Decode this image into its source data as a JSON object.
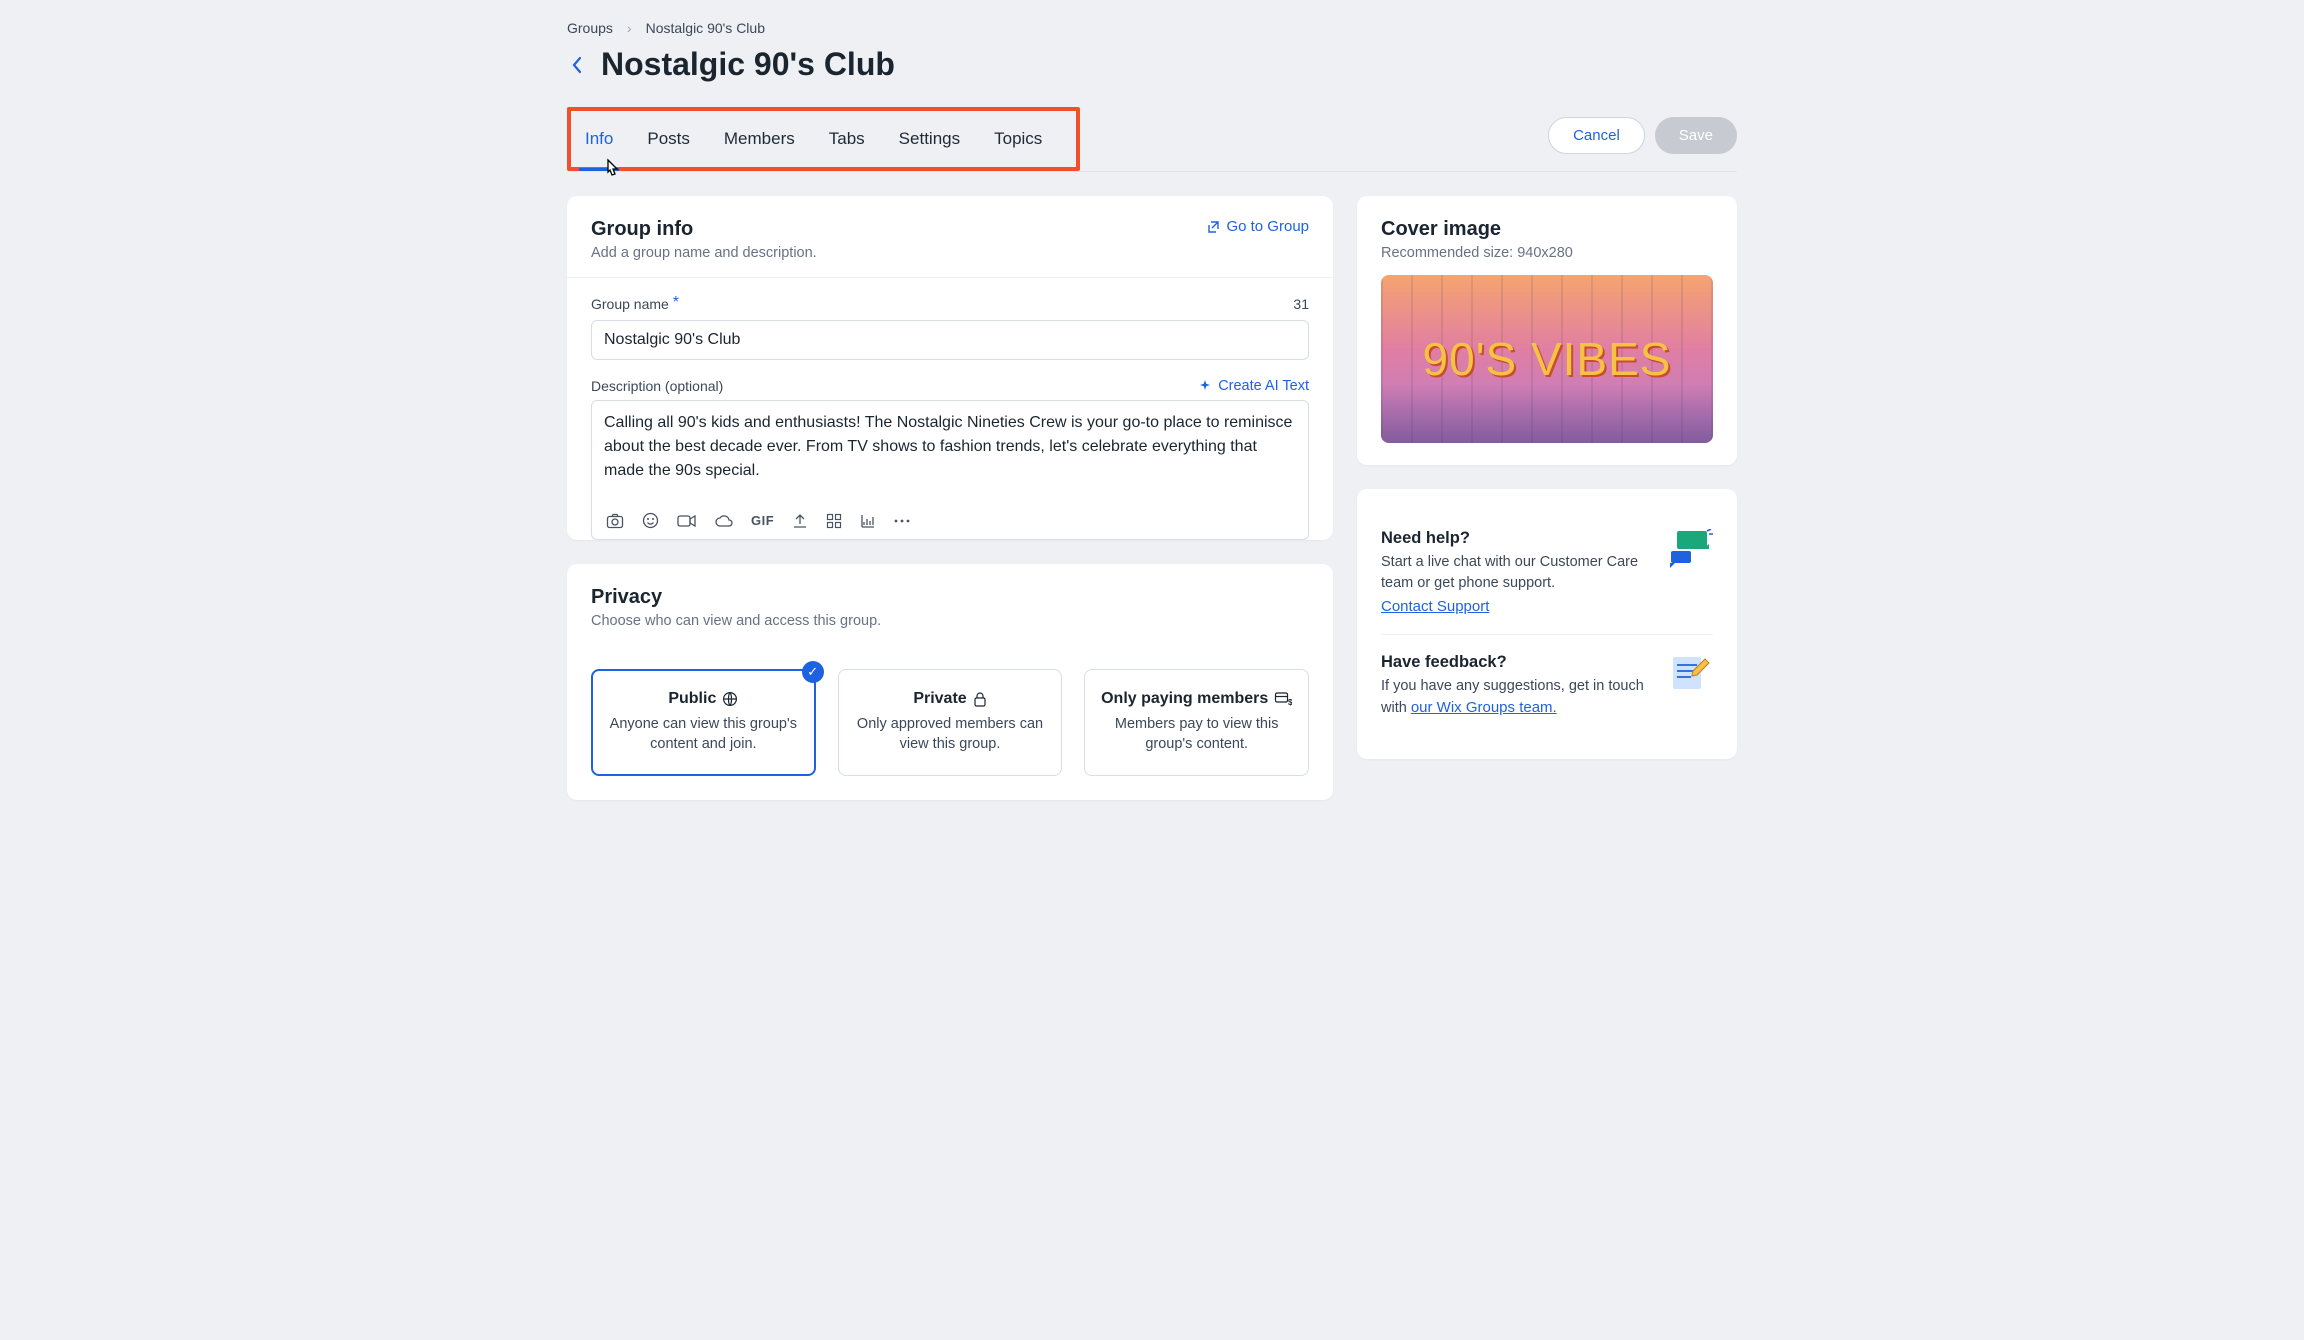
{
  "breadcrumb": {
    "root": "Groups",
    "current": "Nostalgic 90's Club"
  },
  "title": "Nostalgic 90's Club",
  "tabs": [
    "Info",
    "Posts",
    "Members",
    "Tabs",
    "Settings",
    "Topics"
  ],
  "active_tab": "Info",
  "actions": {
    "cancel": "Cancel",
    "save": "Save"
  },
  "group_info": {
    "heading": "Group info",
    "sub": "Add a group name and description.",
    "go_to_group": "Go to Group",
    "group_name_label": "Group name",
    "group_name_value": "Nostalgic 90's Club",
    "char_count": "31",
    "desc_label": "Description (optional)",
    "ai_text": "Create AI Text",
    "desc_value": "Calling all 90's kids and enthusiasts! The Nostalgic Nineties Crew is your go-to place to reminisce about the best decade ever. From TV shows to fashion trends, let's celebrate everything that made the 90s special.",
    "rte_gif": "GIF"
  },
  "privacy": {
    "heading": "Privacy",
    "sub": "Choose who can view and access this group.",
    "options": [
      {
        "title": "Public",
        "desc": "Anyone can view this group's content and join.",
        "selected": true
      },
      {
        "title": "Private",
        "desc": "Only approved members can view this group.",
        "selected": false
      },
      {
        "title": "Only paying members",
        "desc": "Members pay to view this group's content.",
        "selected": false
      }
    ]
  },
  "cover": {
    "heading": "Cover image",
    "sub": "Recommended size: 940x280",
    "banner_text": "90'S VIBES"
  },
  "help": {
    "heading": "Need help?",
    "body": "Start a live chat with our Customer Care team or get phone support.",
    "link": "Contact Support"
  },
  "feedback": {
    "heading": "Have feedback?",
    "body_before": "If you have any suggestions, get in touch with ",
    "link": "our Wix Groups team."
  }
}
